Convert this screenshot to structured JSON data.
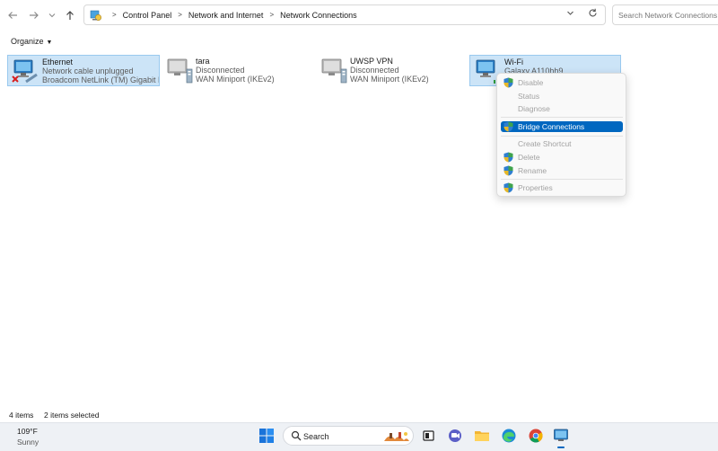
{
  "address": {
    "crumbs": [
      "Control Panel",
      "Network and Internet",
      "Network Connections"
    ],
    "search_placeholder": "Search Network Connections"
  },
  "toolbar": {
    "organize": "Organize"
  },
  "connections": [
    {
      "name": "Ethernet",
      "status": "Network cable unplugged",
      "device": "Broadcom NetLink (TM) Gigabit E...",
      "selected": true
    },
    {
      "name": "tara",
      "status": "Disconnected",
      "device": "WAN Miniport (IKEv2)",
      "selected": false
    },
    {
      "name": "UWSP VPN",
      "status": "Disconnected",
      "device": "WAN Miniport (IKEv2)",
      "selected": false
    },
    {
      "name": "Wi-Fi",
      "status": "Galaxy A110hh9",
      "device": "",
      "selected": true
    }
  ],
  "context_menu": {
    "items": [
      {
        "label": "Disable",
        "shield": true,
        "enabled": false
      },
      {
        "label": "Status",
        "shield": false,
        "enabled": false
      },
      {
        "label": "Diagnose",
        "shield": false,
        "enabled": false
      },
      {
        "label": "Bridge Connections",
        "shield": true,
        "enabled": true,
        "highlighted": true
      },
      {
        "label": "Create Shortcut",
        "shield": false,
        "enabled": false
      },
      {
        "label": "Delete",
        "shield": true,
        "enabled": false
      },
      {
        "label": "Rename",
        "shield": true,
        "enabled": false
      },
      {
        "label": "Properties",
        "shield": true,
        "enabled": false
      }
    ]
  },
  "statusbar": {
    "count": "4 items",
    "selected": "2 items selected"
  },
  "taskbar": {
    "temperature": "109°F",
    "condition": "Sunny",
    "search_label": "Search",
    "apps": [
      "start-icon",
      "widgets-icon",
      "task-view-icon",
      "chat-icon",
      "file-explorer-icon",
      "edge-icon",
      "chrome-icon",
      "control-panel-icon"
    ]
  },
  "colors": {
    "selection": "#cce4f7",
    "accent": "#0067c0",
    "taskbar": "#eef1f5"
  }
}
